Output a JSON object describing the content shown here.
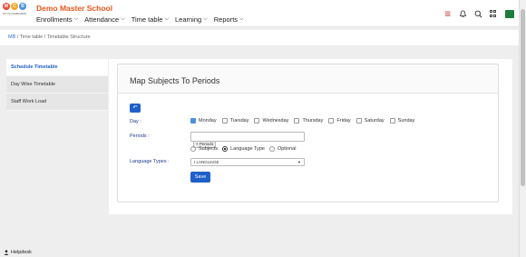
{
  "header": {
    "school_name": "Demo Master School",
    "logo_letters": [
      "M",
      "C",
      "B"
    ],
    "logo_caption": "MY CLASSBOARD",
    "nav": [
      {
        "label": "Enrollments"
      },
      {
        "label": "Attendance"
      },
      {
        "label": "Time table"
      },
      {
        "label": "Learning"
      },
      {
        "label": "Reports"
      }
    ],
    "icons": [
      "abacus-icon",
      "bell-icon",
      "search-icon",
      "grid-icon",
      "app-icon"
    ]
  },
  "breadcrumb": {
    "home": "MB",
    "sep": "/",
    "items": [
      "Time table",
      "Timetable Structure"
    ]
  },
  "sidebar": {
    "items": [
      {
        "label": "Schedule Timetable",
        "active": true
      },
      {
        "label": "Day Wise Timetable",
        "active": false
      },
      {
        "label": "Staff Work Load",
        "active": false
      }
    ]
  },
  "form": {
    "title": "Map Subjects To Periods",
    "back_glyph": "↶",
    "day_label": "Day :",
    "days": [
      {
        "label": "Monday",
        "checked": true
      },
      {
        "label": "Tuesday",
        "checked": false
      },
      {
        "label": "Wednesday",
        "checked": false
      },
      {
        "label": "Thursday",
        "checked": false
      },
      {
        "label": "Friday",
        "checked": false
      },
      {
        "label": "Saturday",
        "checked": false
      },
      {
        "label": "Sunday",
        "checked": false
      }
    ],
    "periods_label": "Periods :",
    "period_tag": "× Period1",
    "types": [
      {
        "label": "Subjects",
        "selected": false
      },
      {
        "label": "Language Type",
        "selected": true
      },
      {
        "label": "Optional",
        "selected": false
      }
    ],
    "language_label": "Language Types :",
    "language_value": "I LANGUAGE",
    "save_label": "Save"
  },
  "footer": {
    "helpdesk": "Helpdesk"
  },
  "colors": {
    "brand": "#e8561a",
    "accent": "#1f5fc9"
  }
}
